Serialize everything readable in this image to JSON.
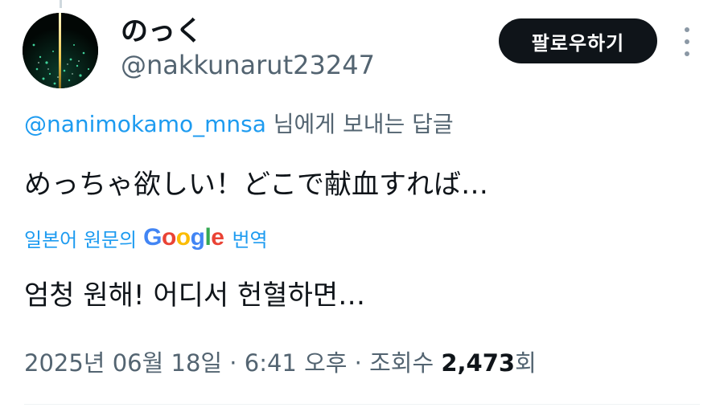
{
  "author": {
    "display_name": "のっく",
    "handle": "@nakkunarut23247"
  },
  "follow_button": {
    "label": "팔로우하기"
  },
  "more_icon": "more-vertical-icon",
  "reply_to": {
    "mention": "@nanimokamo_mnsa",
    "suffix": " 님에게 보내는 답글"
  },
  "tweet": {
    "text": "めっちゃ欲しい！どこで献血すれば…"
  },
  "translation": {
    "prefix": "일본어 원문의",
    "provider": "Google",
    "suffix": "번역",
    "text": "엄청 원해! 어디서 헌혈하면…"
  },
  "meta": {
    "datetime": "2025년 06월 18일 · 6:41 오후 · 조회수 ",
    "views": "2,473",
    "views_suffix": "회"
  },
  "colors": {
    "link": "#1d9bf0",
    "secondary_text": "#536471",
    "button_bg": "#0f1419"
  }
}
